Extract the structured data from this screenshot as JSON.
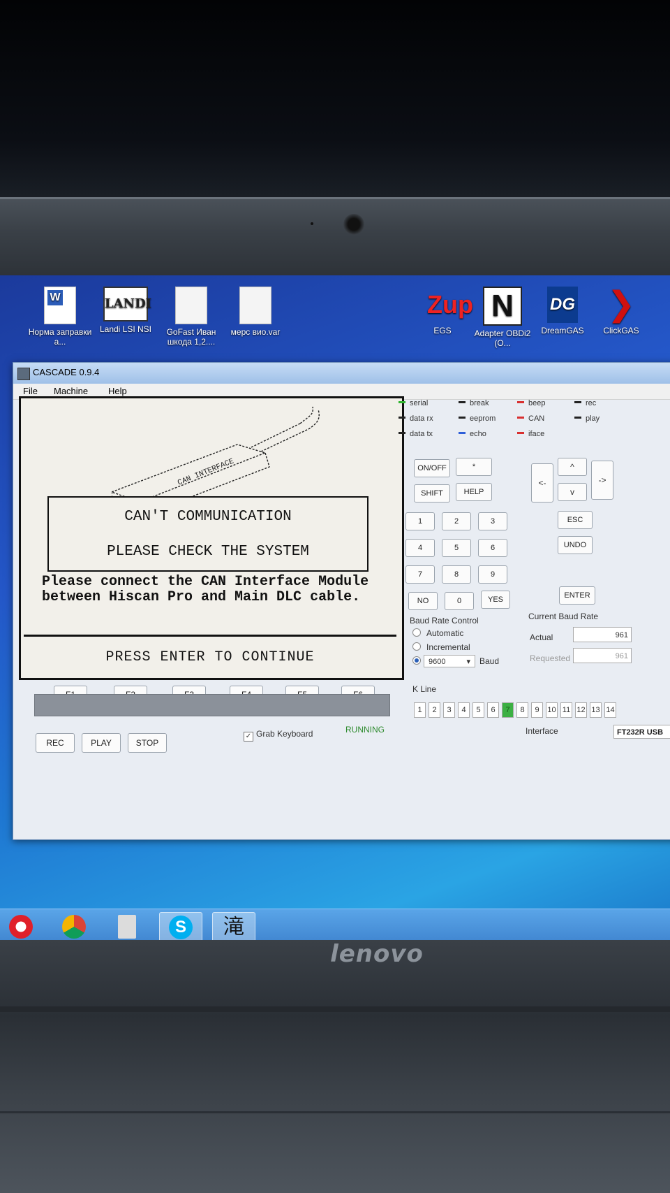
{
  "desktop": {
    "icons": [
      {
        "label": "Норма заправки а...",
        "kind": "word"
      },
      {
        "label": "Landi LSI NSI",
        "kind": "landi",
        "logo_text": "LANDI"
      },
      {
        "label": "GoFast Иван шкода 1,2....",
        "kind": "doc"
      },
      {
        "label": "мерс вио.var",
        "kind": "doc"
      },
      {
        "label": "EGS",
        "kind": "zup",
        "logo_text": "Zup"
      },
      {
        "label": "Adapter OBDi2 (O...",
        "kind": "nlogo",
        "logo_text": "N"
      },
      {
        "label": "DreamGAS",
        "kind": "dg",
        "logo_text": "DG"
      },
      {
        "label": "ClickGAS",
        "kind": "click"
      }
    ]
  },
  "window": {
    "title": "CASCADE 0.9.4",
    "menu": [
      "File",
      "Machine",
      "Help"
    ]
  },
  "display": {
    "cable_label": "CAN INTERFACE",
    "dialog_line1": "CAN'T COMMUNICATION",
    "dialog_line2": "PLEASE CHECK THE SYSTEM",
    "message_line1": "Please connect the CAN Interface Module",
    "message_line2": "between Hiscan Pro and Main DLC cable.",
    "press_prompt": "PRESS ENTER TO CONTINUE"
  },
  "fkeys": [
    "F1",
    "F2",
    "F3",
    "F4",
    "F5",
    "F6"
  ],
  "controls": {
    "rec": "REC",
    "play": "PLAY",
    "stop": "STOP",
    "grab_keyboard": "Grab Keyboard",
    "grab_checked": true,
    "status": "RUNNING"
  },
  "indicators": [
    {
      "label": "serial",
      "color": "#2fb52f"
    },
    {
      "label": "break",
      "color": "#222222"
    },
    {
      "label": "beep",
      "color": "#d83030"
    },
    {
      "label": "rec",
      "color": "#222222"
    },
    {
      "label": "data rx",
      "color": "#222222"
    },
    {
      "label": "eeprom",
      "color": "#222222"
    },
    {
      "label": "CAN",
      "color": "#d83030"
    },
    {
      "label": "play",
      "color": "#222222"
    },
    {
      "label": "data tx",
      "color": "#222222"
    },
    {
      "label": "echo",
      "color": "#2f5fd8"
    },
    {
      "label": "iface",
      "color": "#d83030"
    }
  ],
  "keypad": {
    "onoff": "ON/OFF",
    "star": "*",
    "shift": "SHIFT",
    "help": "HELP",
    "digits": [
      "1",
      "2",
      "3",
      "4",
      "5",
      "6",
      "7",
      "8",
      "9"
    ],
    "no": "NO",
    "zero": "0",
    "yes": "YES",
    "esc": "ESC",
    "undo": "UNDO",
    "enter": "ENTER",
    "left": "<-",
    "right": "->",
    "up": "^",
    "down": "v"
  },
  "baud": {
    "control_title": "Baud Rate Control",
    "automatic": "Automatic",
    "incremental": "Incremental",
    "selected_value": "9600",
    "unit": "Baud",
    "current_title": "Current Baud Rate",
    "actual_label": "Actual",
    "actual_value": "961",
    "requested_label": "Requested",
    "requested_value": "961"
  },
  "kline": {
    "title": "K Line",
    "cells": [
      "1",
      "2",
      "3",
      "4",
      "5",
      "6",
      "7",
      "8",
      "9",
      "10",
      "11",
      "12",
      "13",
      "14"
    ],
    "active": "7"
  },
  "interface": {
    "label": "Interface",
    "value": "FT232R USB"
  },
  "laptop": {
    "brand": "lenovo",
    "taskbar_ime_char": "滝"
  }
}
